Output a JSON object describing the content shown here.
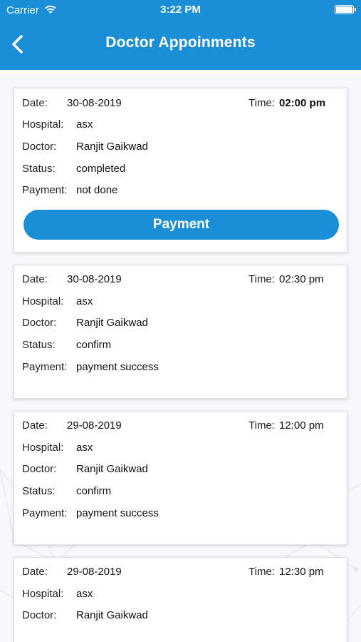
{
  "status_bar": {
    "carrier": "Carrier",
    "time": "3:22 PM"
  },
  "header": {
    "title": "Doctor Appoinments"
  },
  "labels": {
    "date": "Date:",
    "time": "Time:",
    "hospital": "Hospital:",
    "doctor": "Doctor:",
    "status": "Status:",
    "payment": "Payment:"
  },
  "appointments": [
    {
      "date": "30-08-2019",
      "time": "02:00 pm",
      "hospital": "asx",
      "doctor": "Ranjit Gaikwad",
      "status": "completed",
      "payment": "not done",
      "button": "Payment"
    },
    {
      "date": "30-08-2019",
      "time": "02:30 pm",
      "hospital": "asx",
      "doctor": "Ranjit Gaikwad",
      "status": "confirm",
      "payment": "payment success"
    },
    {
      "date": "29-08-2019",
      "time": "12:00 pm",
      "hospital": "asx",
      "doctor": "Ranjit Gaikwad",
      "status": "confirm",
      "payment": "payment success"
    },
    {
      "date": "29-08-2019",
      "time": "12:30 pm",
      "hospital": "asx",
      "doctor": "Ranjit Gaikwad",
      "status": "",
      "payment": ""
    }
  ],
  "colors": {
    "primary": "#1a8fd8",
    "background": "#f6f8fb"
  },
  "icons": {
    "back": "chevron-left-icon",
    "wifi": "wifi-icon",
    "battery": "battery-icon"
  }
}
